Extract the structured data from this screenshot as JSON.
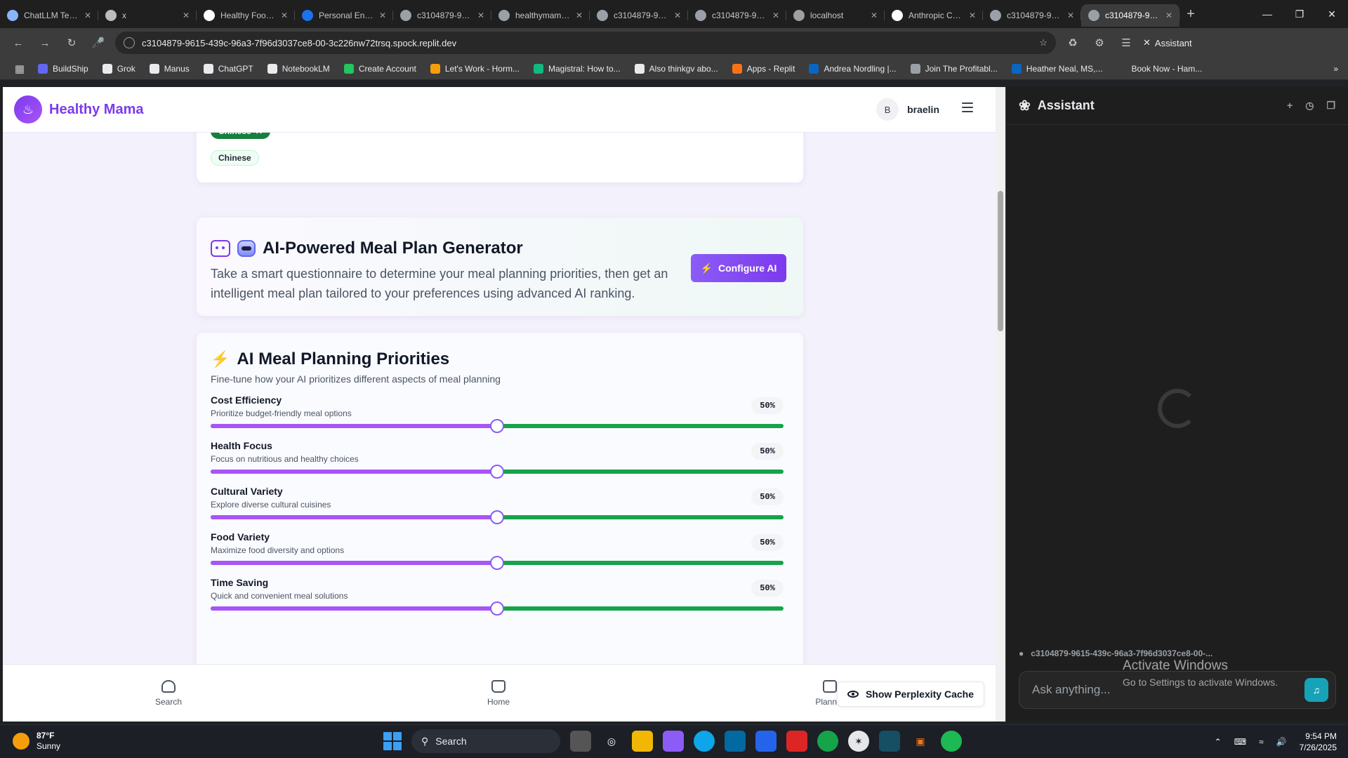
{
  "browser": {
    "tabs": [
      {
        "title": "ChatLLM Teams",
        "favicon_color": "#8ab4f8",
        "active": false
      },
      {
        "title": "x",
        "favicon_color": "#bdbdbd",
        "active": false
      },
      {
        "title": "Healthy Food (@",
        "favicon_color": "#ffffff",
        "active": false
      },
      {
        "title": "Personal Energy /",
        "favicon_color": "#1a73e8",
        "active": false
      },
      {
        "title": "c3104879-9615-4",
        "favicon_color": "#9aa0a6",
        "active": false
      },
      {
        "title": "healthymama.con",
        "favicon_color": "#9aa0a6",
        "active": false
      },
      {
        "title": "c3104879-9615-4",
        "favicon_color": "#9aa0a6",
        "active": false
      },
      {
        "title": "c3104879-9615-4",
        "favicon_color": "#9aa0a6",
        "active": false
      },
      {
        "title": "localhost",
        "favicon_color": "#9aa0a6",
        "active": false
      },
      {
        "title": "Anthropic Consol",
        "favicon_color": "#ffffff",
        "active": false
      },
      {
        "title": "c3104879-9615-4",
        "favicon_color": "#9aa0a6",
        "active": false
      },
      {
        "title": "c3104879-9615-4",
        "favicon_color": "#9aa0a6",
        "active": true
      }
    ],
    "url": "c3104879-9615-439c-96a3-7f96d3037ce8-00-3c226nw72trsq.spock.replit.dev",
    "assistant_label": "Assistant",
    "bookmarks": [
      {
        "label": "BuildShip",
        "color": "#6366f1"
      },
      {
        "label": "Grok",
        "color": "#e8eaed"
      },
      {
        "label": "Manus",
        "color": "#e8eaed"
      },
      {
        "label": "ChatGPT",
        "color": "#e8eaed"
      },
      {
        "label": "NotebookLM",
        "color": "#e8eaed"
      },
      {
        "label": "Create Account",
        "color": "#22c55e"
      },
      {
        "label": "Let's Work - Horm...",
        "color": "#f59e0b"
      },
      {
        "label": "Magistral: How to...",
        "color": "#10b981"
      },
      {
        "label": "Also thinkgv abo...",
        "color": "#e8eaed"
      },
      {
        "label": "Apps - Replit",
        "color": "#f97316"
      },
      {
        "label": "Andrea Nordling |...",
        "color": "#0a66c2"
      },
      {
        "label": "Join The Profitabl...",
        "color": "#9aa0a6"
      },
      {
        "label": "Heather Neal, MS,...",
        "color": "#0a66c2"
      },
      {
        "label": "Book Now - Ham...",
        "color": "#3c3c3c"
      }
    ]
  },
  "app": {
    "brand": "Healthy Mama",
    "user_initial": "B",
    "username": "braelin",
    "cuisine_filters": {
      "active_chip": "Chinese",
      "option_chip": "Chinese"
    },
    "ai_card": {
      "title": "AI-Powered Meal Plan Generator",
      "description": "Take a smart questionnaire to determine your meal planning priorities, then get an intelligent meal plan tailored to your preferences using advanced AI ranking.",
      "button": "Configure AI"
    },
    "priorities": {
      "title": "AI Meal Planning Priorities",
      "subtitle": "Fine-tune how your AI prioritizes different aspects of meal planning",
      "items": [
        {
          "label": "Cost Efficiency",
          "desc": "Prioritize budget-friendly meal options",
          "value": 50,
          "pct": "50%"
        },
        {
          "label": "Health Focus",
          "desc": "Focus on nutritious and healthy choices",
          "value": 50,
          "pct": "50%"
        },
        {
          "label": "Cultural Variety",
          "desc": "Explore diverse cultural cuisines",
          "value": 50,
          "pct": "50%"
        },
        {
          "label": "Food Variety",
          "desc": "Maximize food diversity and options",
          "value": 50,
          "pct": "50%"
        },
        {
          "label": "Time Saving",
          "desc": "Quick and convenient meal solutions",
          "value": 50,
          "pct": "50%"
        }
      ]
    },
    "nav": {
      "search": "Search",
      "home": "Home",
      "planner": "Planner",
      "perplexity": "Show Perplexity Cache"
    },
    "colors": {
      "accent": "#7c3aed",
      "track_remaining": "#16a34a",
      "track_fill": "#a855f7"
    }
  },
  "assistant_panel": {
    "title": "Assistant",
    "context_url": "c3104879-9615-439c-96a3-7f96d3037ce8-00-...",
    "placeholder": "Ask anything...",
    "watermark_title": "Activate Windows",
    "watermark_sub": "Go to Settings to activate Windows."
  },
  "taskbar": {
    "temp": "87°F",
    "condition": "Sunny",
    "search": "Search",
    "time": "9:54 PM",
    "date": "7/26/2025"
  }
}
